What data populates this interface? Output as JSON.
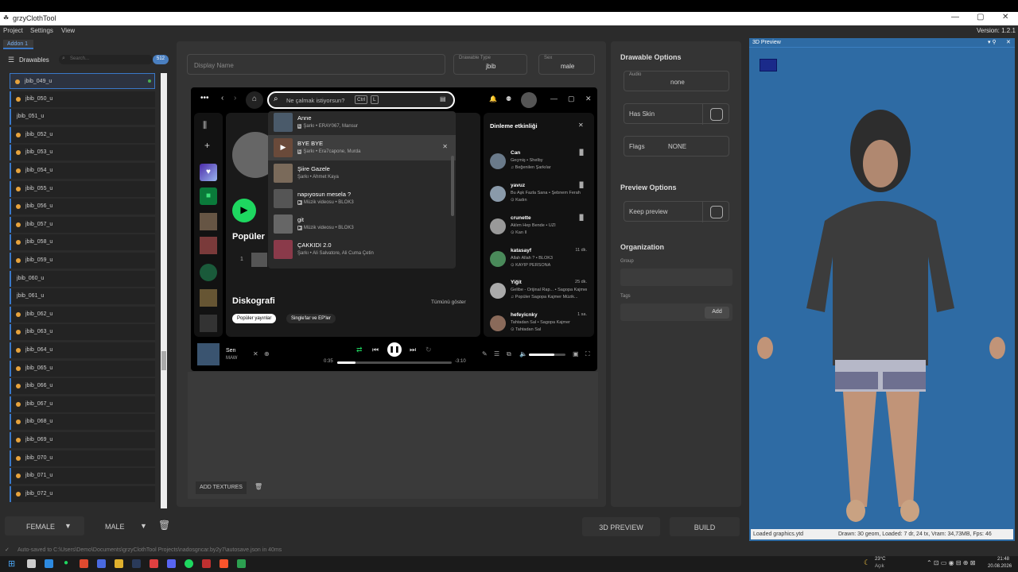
{
  "window": {
    "title": "grzyClothTool",
    "version": "Version: 1.2.1"
  },
  "menu": [
    "Project",
    "Settings",
    "View"
  ],
  "tab": "Addon 1",
  "drawables": {
    "header": "Drawables",
    "search_placeholder": "Search...",
    "count": "512",
    "items": [
      "jbib_049_u",
      "jbib_050_u",
      "jbib_051_u",
      "jbib_052_u",
      "jbib_053_u",
      "jbib_054_u",
      "jbib_055_u",
      "jbib_056_u",
      "jbib_057_u",
      "jbib_058_u",
      "jbib_059_u",
      "jbib_060_u",
      "jbib_061_u",
      "jbib_062_u",
      "jbib_063_u",
      "jbib_064_u",
      "jbib_065_u",
      "jbib_066_u",
      "jbib_067_u",
      "jbib_068_u",
      "jbib_069_u",
      "jbib_070_u",
      "jbib_071_u",
      "jbib_072_u"
    ]
  },
  "details": {
    "display_name_placeholder": "Display Name",
    "drawable_type_label": "Drawable Type",
    "drawable_type_value": "jbib",
    "sex_label": "Sex",
    "sex_value": "male",
    "add_textures": "ADD TEXTURES"
  },
  "spotify": {
    "search_placeholder": "Ne çalmak istiyorsun?",
    "shortcut_ctrl": "Ctrl",
    "shortcut_key": "L",
    "popular_heading": "Popüler",
    "popular_index": "1",
    "discography_heading": "Diskografi",
    "show_all": "Tümünü göster",
    "chip_popular": "Popüler yayınlar",
    "chip_singles": "Single'lar ve EP'ler",
    "results": [
      {
        "title": "Anne",
        "sub": "Şarkı • ERAY067, Mansur",
        "badge": "E"
      },
      {
        "title": "BYE BYE",
        "sub": "Şarkı • Era7capone, Murda",
        "badge": "E"
      },
      {
        "title": "Şiire Gazele",
        "sub": "Şarkı • Ahmet Kaya",
        "badge": ""
      },
      {
        "title": "napıyosun mesela ?",
        "sub": "Müzik videosu • BLOK3",
        "badge": "▶"
      },
      {
        "title": "git",
        "sub": "Müzik videosu • BLOK3",
        "badge": "▶"
      },
      {
        "title": "ÇAKKIDI 2.0",
        "sub": "Şarkı • Ali Salvatore, Ali Cuma Çetin",
        "badge": ""
      }
    ],
    "friends_title": "Dinleme etkinliği",
    "friends": [
      {
        "name": "Can",
        "song": "Geçmiş • Shelby",
        "ctx": "♫ Beğenilen Şarkılar",
        "time": ""
      },
      {
        "name": "yavuz",
        "song": "Bu Aşk Fazla Sana • Şebnem Ferah",
        "ctx": "⊙ Kadın",
        "time": ""
      },
      {
        "name": "crunette",
        "song": "Aklım Hep Bende • UZI",
        "ctx": "⊙ Kan II",
        "time": ""
      },
      {
        "name": "katasayf",
        "song": "Allah Allah ? • BLOK3",
        "ctx": "⊙ KAYIP PERSONA",
        "time": "11 dk."
      },
      {
        "name": "Yiğit",
        "song": "Gelibe - Orijinal Rap... • Sagopa Kajmer",
        "ctx": "♫ Popüler Sagopa Kajmer Müzik...",
        "time": "25 dk."
      },
      {
        "name": "hefeyicnky",
        "song": "Tahtadan Sal • Sagopa Kajmer",
        "ctx": "⊙ Tahtadan Sal",
        "time": "1 sa."
      }
    ],
    "now_playing": {
      "title": "Sen",
      "artist": "MAW",
      "elapsed": "0:35",
      "remaining": "-3:10",
      "progress": 0.16,
      "volume": 0.7
    }
  },
  "options": {
    "drawable_options": "Drawable Options",
    "audio_label": "Audio",
    "audio_value": "none",
    "has_skin": "Has Skin",
    "flags_label": "Flags",
    "flags_value": "NONE",
    "preview_options": "Preview Options",
    "keep_preview": "Keep preview",
    "organization": "Organization",
    "group_label": "Group",
    "tags_label": "Tags",
    "add": "Add"
  },
  "preview": {
    "title": "3D Preview",
    "status_left": "Loaded graphics.ytd",
    "status_right": "Drawn: 30 geom, Loaded: 7 dr, 24 tx, Vram: 34,73MB, Fps: 46"
  },
  "bottom": {
    "female": "FEMALE",
    "male": "MALE",
    "preview_btn": "3D PREVIEW",
    "build_btn": "BUILD"
  },
  "status_line": "Auto-saved to C:\\Users\\Demo\\Documents\\grzyClothTool Projects\\nadosgncar.by2y7\\autosave.json in 40ms",
  "taskbar": {
    "weather_temp": "23°C",
    "weather_desc": "Açık",
    "time": "21:48",
    "date": "20.08.2026"
  }
}
